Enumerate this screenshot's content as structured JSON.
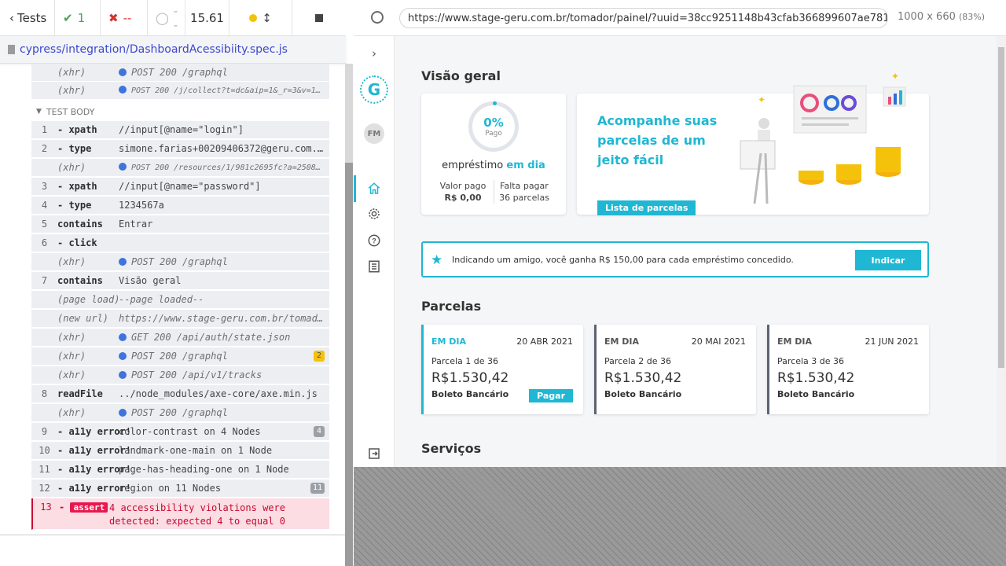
{
  "reporter": {
    "tests_label": "Tests",
    "passed": "1",
    "failed": "--",
    "pending": "--",
    "duration": "15.61",
    "spec_path": "cypress/integration/DashboardAcessibiity.spec.js",
    "top_rows": [
      {
        "name": "(xhr)",
        "msg": "POST 200 /graphql"
      },
      {
        "name": "(xhr)",
        "msg": "POST 200 /j/collect?t=dc&aip=1&_r=3&v=1…"
      }
    ],
    "section": "TEST BODY",
    "rows": [
      {
        "num": "1",
        "name": "- xpath",
        "msg": "//input[@name=\"login\"]"
      },
      {
        "num": "2",
        "name": "- type",
        "msg": "simone.farias+00209406372@geru.com.…"
      },
      {
        "num": "",
        "name": "(xhr)",
        "msg": "POST 200 /resources/1/981c2695fc?a=2508…",
        "xhr": true,
        "small": true
      },
      {
        "num": "3",
        "name": "- xpath",
        "msg": "//input[@name=\"password\"]"
      },
      {
        "num": "4",
        "name": "- type",
        "msg": "1234567a"
      },
      {
        "num": "5",
        "name": "contains",
        "msg": "Entrar"
      },
      {
        "num": "6",
        "name": "- click",
        "msg": ""
      },
      {
        "num": "",
        "name": "(xhr)",
        "msg": "POST 200 /graphql",
        "xhr": true
      },
      {
        "num": "7",
        "name": "contains",
        "msg": "Visão geral"
      },
      {
        "num": "",
        "name": "(page load)",
        "msg": "--page loaded--",
        "italic": true
      },
      {
        "num": "",
        "name": "(new url)",
        "msg": "https://www.stage-geru.com.br/tomad…",
        "italic": true
      },
      {
        "num": "",
        "name": "(xhr)",
        "msg": "GET 200 /api/auth/state.json",
        "xhr": true
      },
      {
        "num": "",
        "name": "(xhr)",
        "msg": "POST 200 /graphql",
        "xhr": true,
        "badge": "2"
      },
      {
        "num": "",
        "name": "(xhr)",
        "msg": "POST 200 /api/v1/tracks",
        "xhr": true
      },
      {
        "num": "8",
        "name": "readFile",
        "msg": "../node_modules/axe-core/axe.min.js"
      },
      {
        "num": "",
        "name": "(xhr)",
        "msg": "POST 200 /graphql",
        "xhr": true
      },
      {
        "num": "9",
        "name": "- a11y error!",
        "msg": "color-contrast on 4 Nodes",
        "badge": "4"
      },
      {
        "num": "10",
        "name": "- a11y error!",
        "msg": "landmark-one-main on 1 Node"
      },
      {
        "num": "11",
        "name": "- a11y error!",
        "msg": "page-has-heading-one on 1 Node"
      },
      {
        "num": "12",
        "name": "- a11y error!",
        "msg": "region on 11 Nodes",
        "badge": "11"
      }
    ],
    "assert": {
      "num": "13",
      "tag": "assert",
      "line1": "4 accessibility violations were",
      "line2": "detected: expected 4 to equal 0"
    }
  },
  "browser": {
    "url": "https://www.stage-geru.com.br/tomador/painel/?uuid=38cc9251148b43cfab366899607ae781",
    "viewport": "1000 x 660",
    "zoom": "(83%)"
  },
  "app": {
    "logo": "G",
    "avatar": "FM",
    "overview_title": "Visão geral",
    "progress": {
      "pct": "0%",
      "label": "Pago",
      "status_prefix": "empréstimo",
      "status": "em dia"
    },
    "paid_label": "Valor pago",
    "paid_value": "R$ 0,00",
    "remaining_label": "Falta pagar",
    "remaining_value": "36 parcelas",
    "promo_title": "Acompanhe suas parcelas de um jeito fácil",
    "promo_button": "Lista de parcelas",
    "referral_text": "Indicando um amigo, você ganha R$ 150,00 para cada empréstimo concedido.",
    "referral_button": "Indicar",
    "installments_title": "Parcelas",
    "installments": [
      {
        "status": "EM DIA",
        "date": "20 ABR 2021",
        "parcela": "Parcela 1 de 36",
        "value": "R$1.530,42",
        "method": "Boleto Bancário",
        "pay": "Pagar",
        "color": "#1fb7d3"
      },
      {
        "status": "EM DIA",
        "date": "20 MAI 2021",
        "parcela": "Parcela 2 de 36",
        "value": "R$1.530,42",
        "method": "Boleto Bancário",
        "color": "#5b6273"
      },
      {
        "status": "EM DIA",
        "date": "21 JUN 2021",
        "parcela": "Parcela 3 de 36",
        "value": "R$1.530,42",
        "method": "Boleto Bancário",
        "color": "#5b6273"
      }
    ],
    "services_title": "Serviços"
  }
}
